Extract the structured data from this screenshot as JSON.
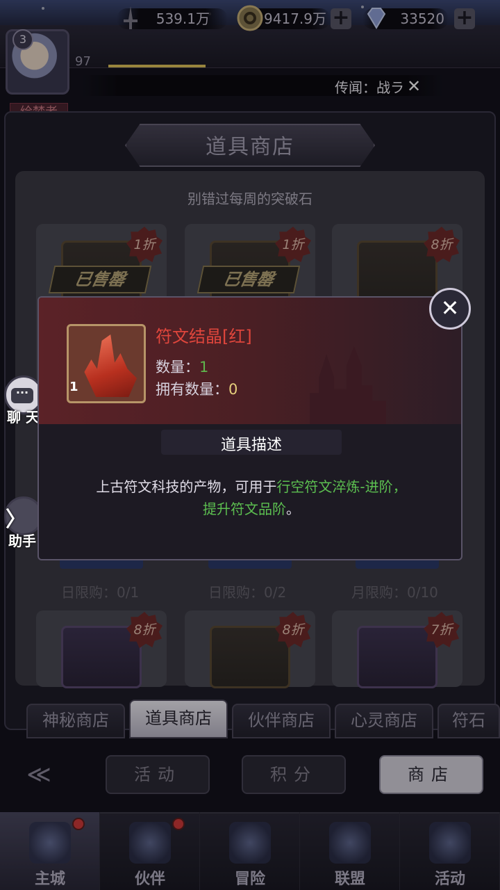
{
  "header": {
    "level": "3",
    "exp_level_text": "97",
    "player_title": "绘梦者",
    "resources": [
      {
        "name": "sword-power-icon",
        "value": "539.1万"
      },
      {
        "name": "gold-coin-icon",
        "value": "9417.9万"
      },
      {
        "name": "diamond-icon",
        "value": "33520"
      }
    ],
    "plus_label": "+",
    "rumor": "传闻：战ラ",
    "rumor_close": "✕"
  },
  "shop": {
    "title": "道具商店",
    "subtitle": "别错过每周的突破石",
    "cards_row1": [
      {
        "discount": "1折",
        "sold_out": "已售罄",
        "limit": "日限购：0/1"
      },
      {
        "discount": "1折",
        "sold_out": "已售罄",
        "limit": "日限购：0/2"
      },
      {
        "discount": "8折",
        "sold_out": "",
        "limit": "月限购：0/10"
      }
    ],
    "cards_row2": [
      {
        "discount": "8折"
      },
      {
        "discount": "8折"
      },
      {
        "discount": "7折"
      }
    ]
  },
  "side": {
    "chat_label": "聊 天",
    "chat_dots": "···",
    "helper_label": "助手",
    "helper_arrow": "〉"
  },
  "tabs": [
    {
      "label": "神秘商店",
      "active": false
    },
    {
      "label": "道具商店",
      "active": true
    },
    {
      "label": "伙伴商店",
      "active": false
    },
    {
      "label": "心灵商店",
      "active": false
    },
    {
      "label": "符石",
      "active": false
    }
  ],
  "subnav": [
    {
      "label": "活动",
      "active": false
    },
    {
      "label": "积分",
      "active": false
    },
    {
      "label": "商店",
      "active": true
    }
  ],
  "bottom_nav": [
    {
      "label": "主城",
      "active": true,
      "badge": true
    },
    {
      "label": "伙伴",
      "active": false,
      "badge": true
    },
    {
      "label": "冒险",
      "active": false,
      "badge": false
    },
    {
      "label": "联盟",
      "active": false,
      "badge": false
    },
    {
      "label": "活动",
      "active": false,
      "badge": false
    }
  ],
  "modal": {
    "item_name": "符文结晶[红]",
    "item_stack_count": "1",
    "qty_label": "数量：",
    "qty_value": "1",
    "own_label": "拥有数量：",
    "own_value": "0",
    "desc_title": "道具描述",
    "desc_line1_a": "上古符文科技的产物，可用于",
    "desc_line1_b": "行空符文淬炼-进阶，",
    "desc_line2_b": "提升符文品阶",
    "desc_line2_c": "。",
    "close_label": "✕"
  },
  "colors": {
    "item_name_red": "#e0463c",
    "highlight_green": "#5cbf50",
    "own_value_yellow": "#e6cf7c"
  }
}
